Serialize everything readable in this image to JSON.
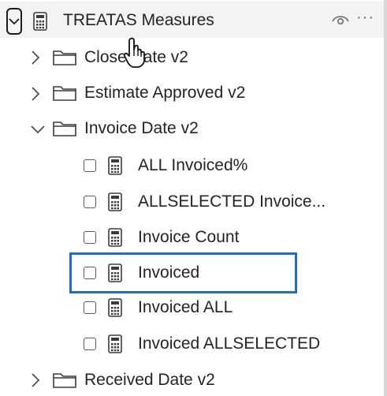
{
  "header": {
    "title": "TREATAS Measures",
    "chevron_icon": "chevron-down-icon",
    "table_icon": "calculator-icon",
    "visibility_icon": "eye-icon",
    "more_label": "···"
  },
  "folders": [
    {
      "label": "Close Date v2",
      "expanded": false
    },
    {
      "label": "Estimate Approved v2",
      "expanded": false
    },
    {
      "label": "Invoice Date v2",
      "expanded": true
    },
    {
      "label": "Received Date v2",
      "expanded": false
    }
  ],
  "measures": [
    {
      "label": "ALL Invoiced%",
      "checked": false
    },
    {
      "label": "ALLSELECTED Invoice...",
      "checked": false
    },
    {
      "label": "Invoice Count",
      "checked": false
    },
    {
      "label": "Invoiced",
      "checked": false,
      "highlighted": true
    },
    {
      "label": "Invoiced ALL",
      "checked": false
    },
    {
      "label": "Invoiced ALLSELECTED",
      "checked": false
    }
  ],
  "colors": {
    "highlight": "#1f6fbd",
    "header_bg": "#f3f3f3",
    "text": "#252423"
  }
}
